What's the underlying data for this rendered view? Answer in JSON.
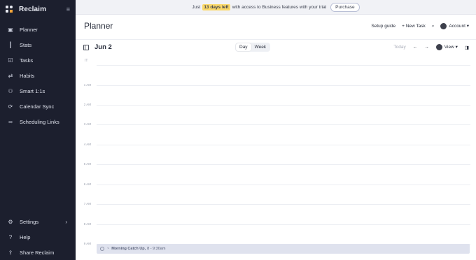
{
  "app": {
    "name": "Reclaim",
    "collapse_icon": "sidebar-collapse-icon"
  },
  "sidebar": {
    "items": [
      {
        "label": "Planner",
        "icon": "calendar-icon",
        "glyph": "▣"
      },
      {
        "label": "Stats",
        "icon": "bar-chart-icon",
        "glyph": "┃"
      },
      {
        "label": "Tasks",
        "icon": "checkbox-icon",
        "glyph": "☑"
      },
      {
        "label": "Habits",
        "icon": "repeat-icon",
        "glyph": "⇄"
      },
      {
        "label": "Smart 1:1s",
        "icon": "people-icon",
        "glyph": "⚇"
      },
      {
        "label": "Calendar Sync",
        "icon": "sync-icon",
        "glyph": "⟳"
      },
      {
        "label": "Scheduling Links",
        "icon": "link-icon",
        "glyph": "∞"
      }
    ],
    "bottom_items": [
      {
        "label": "Settings",
        "icon": "gear-icon",
        "glyph": "⚙"
      },
      {
        "label": "Help",
        "icon": "help-icon",
        "glyph": "?"
      },
      {
        "label": "Share Reclaim",
        "icon": "share-icon",
        "glyph": "⇪"
      }
    ]
  },
  "banner": {
    "prefix": "Just",
    "highlight": "13 days left",
    "suffix": "with access to Business features with your trial",
    "button": "Purchase"
  },
  "header": {
    "title": "Planner",
    "setup_guide": "Setup guide",
    "new_task": "+ New Task",
    "account": "Account"
  },
  "toolbar": {
    "date": "Jun 2",
    "views": [
      "Day",
      "Week"
    ],
    "active_view": "Day",
    "today": "Today",
    "prev": "←",
    "next": "→",
    "view_menu": "View"
  },
  "calendar": {
    "timezone": "IT",
    "hours": [
      "1 AM",
      "2 AM",
      "3 AM",
      "4 AM",
      "5 AM",
      "6 AM",
      "7 AM",
      "8 AM",
      "9 AM"
    ],
    "event": {
      "title": "Morning Catch Up,",
      "time": "8 - 9:30am",
      "prefix": "~"
    }
  },
  "colors": {
    "sidebar_bg": "#1c1f2e",
    "banner_highlight": "#fbd96a",
    "event_bg": "#dfe2ee"
  }
}
